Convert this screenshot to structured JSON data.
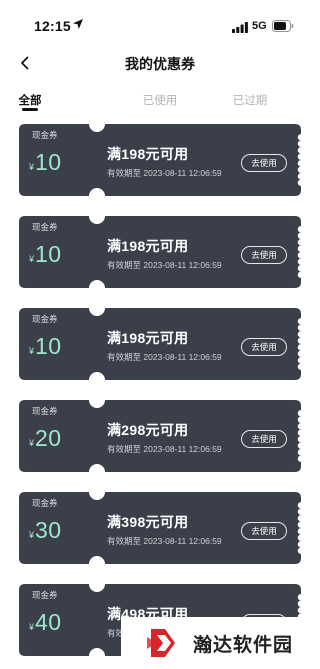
{
  "status_bar": {
    "time": "12:15",
    "network": "5G",
    "icons": [
      "location-arrow-icon",
      "signal-icon",
      "battery-icon"
    ]
  },
  "nav": {
    "title": "我的优惠券",
    "back_icon": "back-arrow-icon"
  },
  "tabs": [
    {
      "label": "全部",
      "active": true
    },
    {
      "label": "已使用",
      "active": false
    },
    {
      "label": "已过期",
      "active": false
    }
  ],
  "coupons": [
    {
      "tag": "现金券",
      "currency": "¥",
      "value": "10",
      "condition": "满198元可用",
      "validity": "有效期至 2023-08-11 12:06:59",
      "button": "去使用"
    },
    {
      "tag": "现金券",
      "currency": "¥",
      "value": "10",
      "condition": "满198元可用",
      "validity": "有效期至 2023-08-11 12:06:59",
      "button": "去使用"
    },
    {
      "tag": "现金券",
      "currency": "¥",
      "value": "10",
      "condition": "满198元可用",
      "validity": "有效期至 2023-08-11 12:06:59",
      "button": "去使用"
    },
    {
      "tag": "现金券",
      "currency": "¥",
      "value": "20",
      "condition": "满298元可用",
      "validity": "有效期至 2023-08-11 12:06:59",
      "button": "去使用"
    },
    {
      "tag": "现金券",
      "currency": "¥",
      "value": "30",
      "condition": "满398元可用",
      "validity": "有效期至 2023-08-11 12:06:59",
      "button": "去使用"
    },
    {
      "tag": "现金券",
      "currency": "¥",
      "value": "40",
      "condition": "满498元可用",
      "validity": "有效期至 2023-08-11 12:06:59",
      "button": "去使用"
    }
  ],
  "colors": {
    "coupon_bg": "#3b3f4a",
    "coupon_value": "#9fe6cc",
    "watermark_red": "#d8252b"
  },
  "watermark": {
    "text": "瀚达软件园",
    "logo": "handa-logo"
  }
}
